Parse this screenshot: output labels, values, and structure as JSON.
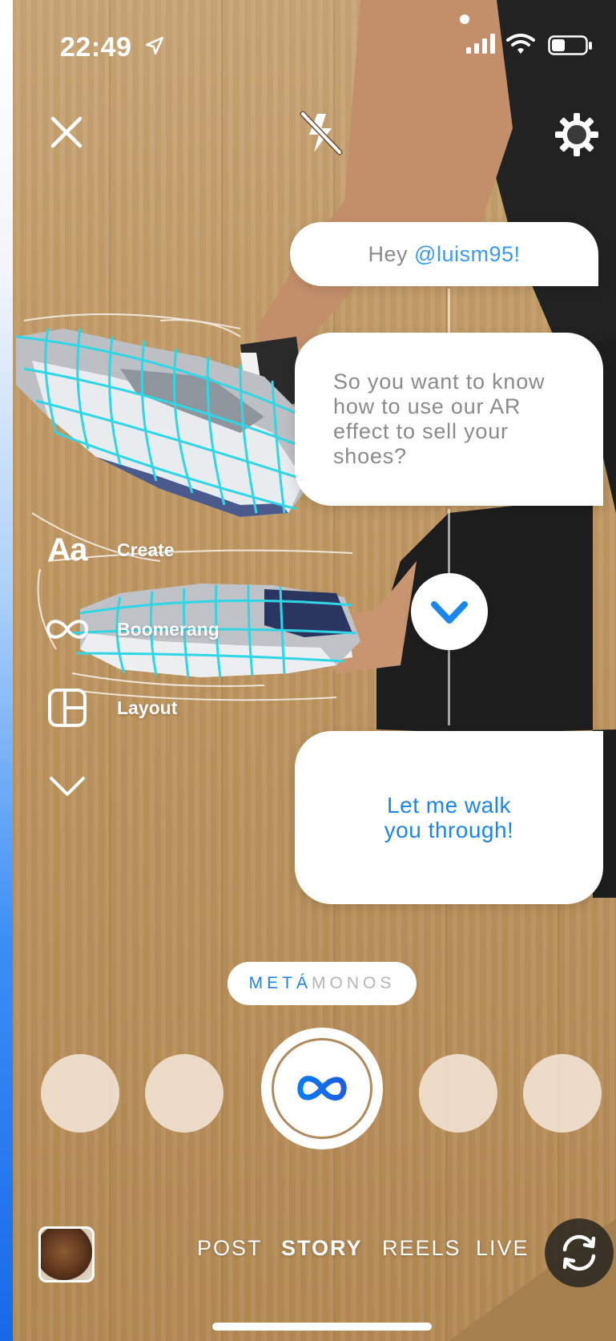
{
  "status_bar": {
    "time": "22:49"
  },
  "chat": {
    "bubble1_prefix": "Hey ",
    "bubble1_mention": "@luism95!",
    "bubble2_text": "So you want to know how to use our AR effect to sell your shoes?",
    "bubble3_text": "Let me walk you through!"
  },
  "tools": {
    "create_icon_text": "Aa",
    "create_label": "Create",
    "boomerang_label": "Boomerang",
    "layout_label": "Layout"
  },
  "effect": {
    "name_accent": "METÁ",
    "name_rest": "MONOS"
  },
  "modes": {
    "post": "POST",
    "story": "STORY",
    "reels": "REELS",
    "live": "LIVE"
  },
  "colors": {
    "accent_blue": "#1e85e6",
    "mention_blue": "#3a9bf0",
    "ar_mesh": "#2fd6e6"
  },
  "icons": {
    "close": "close-icon",
    "flash": "flash-off-icon",
    "settings": "gear-icon",
    "chevron": "chevron-down-icon",
    "boomerang": "infinity-icon",
    "layout": "layout-grid-icon",
    "flip": "camera-flip-icon",
    "capture": "meta-logo-icon"
  }
}
